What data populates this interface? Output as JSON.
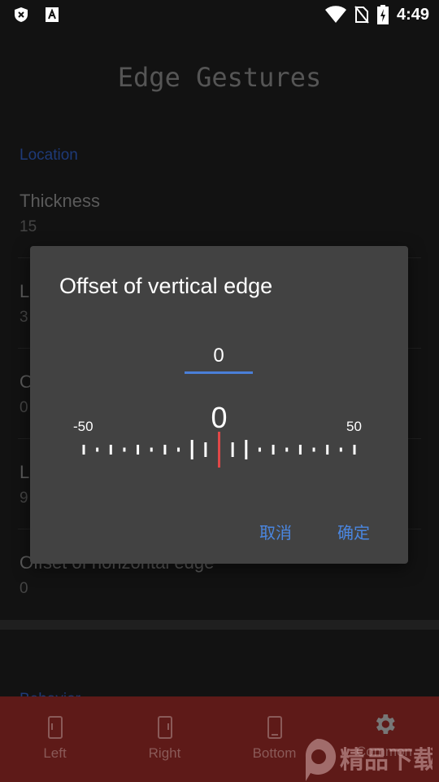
{
  "status_bar": {
    "time": "4:49",
    "icons": [
      "shield-x-icon",
      "font-a-icon",
      "wifi-icon",
      "no-sim-icon",
      "battery-charging-icon"
    ]
  },
  "app": {
    "title": "Edge Gestures"
  },
  "settings": {
    "section": "Location",
    "items": [
      {
        "title": "Thickness",
        "value": "15"
      },
      {
        "title": "L",
        "value": "3"
      },
      {
        "title": "O",
        "value": "0"
      },
      {
        "title": "L",
        "value": "9"
      },
      {
        "title": "Offset of horizontal edge",
        "value": "0"
      }
    ],
    "section2": "Behavior"
  },
  "dialog": {
    "title": "Offset of vertical edge",
    "input_value": "0",
    "slider": {
      "min": "-50",
      "max": "50",
      "current": "0",
      "value": 0,
      "range": [
        -50,
        50
      ],
      "tick_step": 5
    },
    "cancel": "取消",
    "ok": "确定",
    "accent": "#4a86e0",
    "indicator_color": "#e04848"
  },
  "nav": {
    "tabs": [
      {
        "label": "Left",
        "icon": "phone-left-icon"
      },
      {
        "label": "Right",
        "icon": "phone-right-icon"
      },
      {
        "label": "Bottom",
        "icon": "phone-bottom-icon"
      },
      {
        "label": "Common",
        "icon": "gear-icon"
      }
    ],
    "background": "#5e1a18"
  },
  "watermark": {
    "text": "精品下载",
    "url_text": "www.j9p.com"
  }
}
